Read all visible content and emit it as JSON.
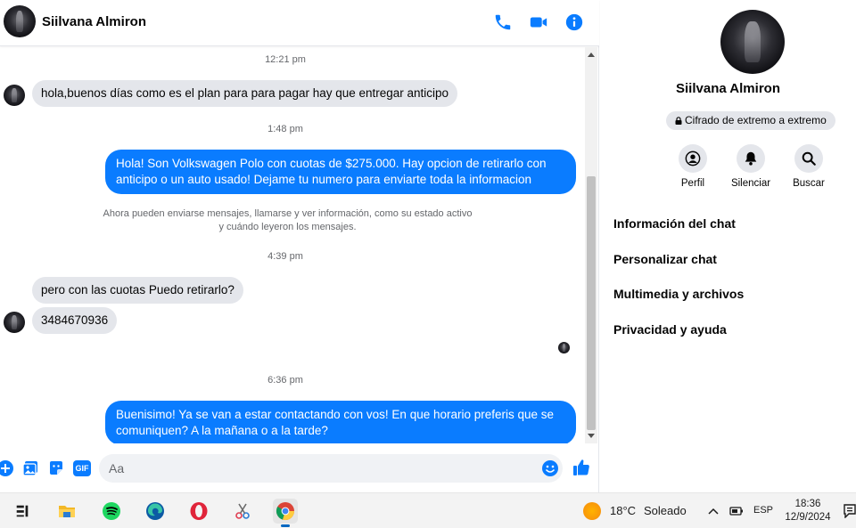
{
  "header": {
    "contact_name": "Siilvana Almiron",
    "icons": [
      "phone-icon",
      "video-icon",
      "info-icon"
    ],
    "accent_color": "#0a7cff"
  },
  "messages": {
    "time_1": "12:21 pm",
    "msg_1": "hola,buenos días como es el plan para para pagar hay que entregar anticipo",
    "time_2": "1:48 pm",
    "msg_2_line1": "Hola! Son Volkswagen Polo con cuotas de $275.000. Hay opcion de retirarlo con",
    "msg_2_line2": "anticipo o un auto usado! Dejame tu numero para enviarte toda la informacion",
    "system_line1": "Ahora pueden enviarse mensajes, llamarse y ver información, como su estado activo",
    "system_line2": "y cuándo leyeron los mensajes.",
    "time_3": "4:39 pm",
    "msg_3": "pero con las cuotas Puedo retirarlo?",
    "msg_4": "3484670936",
    "time_4": "6:36 pm",
    "msg_5_line1": "Buenisimo! Ya se van a estar contactando con vos! En que horario preferis que se",
    "msg_5_line2": "comuniquen? A la mañana o a la tarde?"
  },
  "composer": {
    "placeholder": "Aa",
    "icons": [
      "plus-icon",
      "image-icon",
      "sticker-icon",
      "gif-icon",
      "emoji-icon",
      "like-icon"
    ],
    "gif_label": "GIF"
  },
  "sidebar": {
    "name": "Siilvana Almiron",
    "e2e_label": "Cifrado de extremo a extremo",
    "actions": [
      {
        "label": "Perfil",
        "icon": "profile-icon"
      },
      {
        "label": "Silenciar",
        "icon": "bell-icon"
      },
      {
        "label": "Buscar",
        "icon": "search-icon"
      }
    ],
    "items": [
      {
        "label": "Información del chat"
      },
      {
        "label": "Personalizar chat"
      },
      {
        "label": "Multimedia y archivos"
      },
      {
        "label": "Privacidad y ayuda"
      }
    ]
  },
  "taskbar": {
    "apps": [
      "task-view-icon",
      "file-explorer-icon",
      "spotify-icon",
      "edge-icon",
      "opera-icon",
      "snipping-tool-icon",
      "chrome-icon"
    ],
    "weather_temp": "18°C",
    "weather_desc": "Soleado",
    "language": "ESP",
    "time": "18:36",
    "date": "12/9/2024"
  }
}
